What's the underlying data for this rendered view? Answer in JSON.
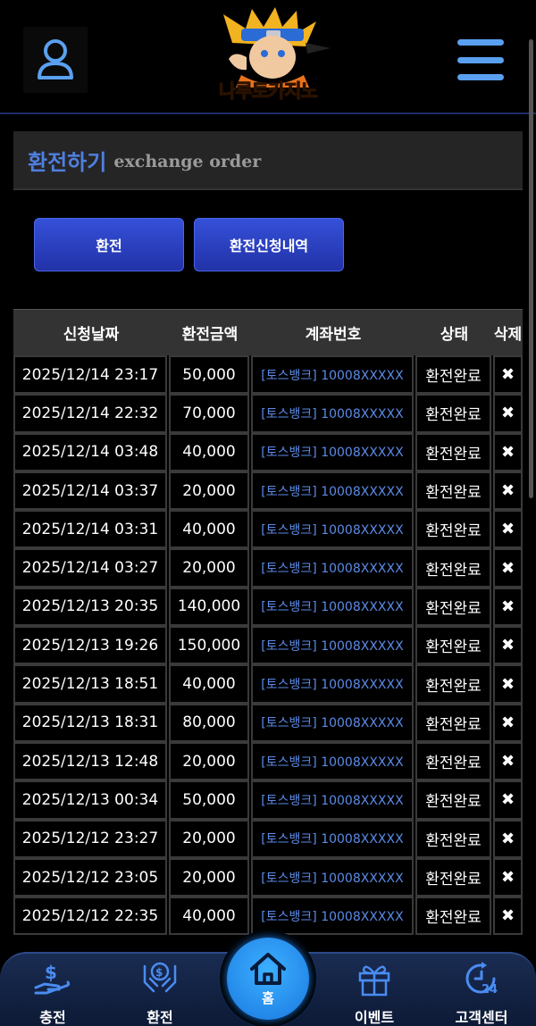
{
  "header": {
    "logo_text": "나루토카지노",
    "user_icon": "user-icon",
    "menu_icon": "hamburger-menu-icon"
  },
  "page": {
    "title_ko": "환전하기",
    "title_en": "exchange order"
  },
  "tabs": {
    "exchange_label": "환전",
    "history_label": "환전신청내역"
  },
  "table": {
    "headers": {
      "date": "신청날짜",
      "amount": "환전금액",
      "account": "계좌번호",
      "status": "상태",
      "delete": "삭제"
    },
    "rows": [
      {
        "date": "2025/12/14 23:17",
        "amount": "50,000",
        "account": "[토스뱅크] 10008XXXXX",
        "status": "환전완료",
        "delete": "✖"
      },
      {
        "date": "2025/12/14 22:32",
        "amount": "70,000",
        "account": "[토스뱅크] 10008XXXXX",
        "status": "환전완료",
        "delete": "✖"
      },
      {
        "date": "2025/12/14 03:48",
        "amount": "40,000",
        "account": "[토스뱅크] 10008XXXXX",
        "status": "환전완료",
        "delete": "✖"
      },
      {
        "date": "2025/12/14 03:37",
        "amount": "20,000",
        "account": "[토스뱅크] 10008XXXXX",
        "status": "환전완료",
        "delete": "✖"
      },
      {
        "date": "2025/12/14 03:31",
        "amount": "40,000",
        "account": "[토스뱅크] 10008XXXXX",
        "status": "환전완료",
        "delete": "✖"
      },
      {
        "date": "2025/12/14 03:27",
        "amount": "20,000",
        "account": "[토스뱅크] 10008XXXXX",
        "status": "환전완료",
        "delete": "✖"
      },
      {
        "date": "2025/12/13 20:35",
        "amount": "140,000",
        "account": "[토스뱅크] 10008XXXXX",
        "status": "환전완료",
        "delete": "✖"
      },
      {
        "date": "2025/12/13 19:26",
        "amount": "150,000",
        "account": "[토스뱅크] 10008XXXXX",
        "status": "환전완료",
        "delete": "✖"
      },
      {
        "date": "2025/12/13 18:51",
        "amount": "40,000",
        "account": "[토스뱅크] 10008XXXXX",
        "status": "환전완료",
        "delete": "✖"
      },
      {
        "date": "2025/12/13 18:31",
        "amount": "80,000",
        "account": "[토스뱅크] 10008XXXXX",
        "status": "환전완료",
        "delete": "✖"
      },
      {
        "date": "2025/12/13 12:48",
        "amount": "20,000",
        "account": "[토스뱅크] 10008XXXXX",
        "status": "환전완료",
        "delete": "✖"
      },
      {
        "date": "2025/12/13 00:34",
        "amount": "50,000",
        "account": "[토스뱅크] 10008XXXXX",
        "status": "환전완료",
        "delete": "✖"
      },
      {
        "date": "2025/12/12 23:27",
        "amount": "20,000",
        "account": "[토스뱅크] 10008XXXXX",
        "status": "환전완료",
        "delete": "✖"
      },
      {
        "date": "2025/12/12 23:05",
        "amount": "20,000",
        "account": "[토스뱅크] 10008XXXXX",
        "status": "환전완료",
        "delete": "✖"
      },
      {
        "date": "2025/12/12 22:35",
        "amount": "40,000",
        "account": "[토스뱅크] 10008XXXXX",
        "status": "환전완료",
        "delete": "✖"
      }
    ]
  },
  "bottom_nav": {
    "deposit_label": "충전",
    "exchange_label": "환전",
    "home_label": "홈",
    "event_label": "이벤트",
    "support_label": "고객센터"
  },
  "colors": {
    "accent_blue": "#4f7fe0",
    "button_blue": "#2a3fc0",
    "account_text": "#5b8ae6",
    "home_button": "#1a78e0"
  }
}
